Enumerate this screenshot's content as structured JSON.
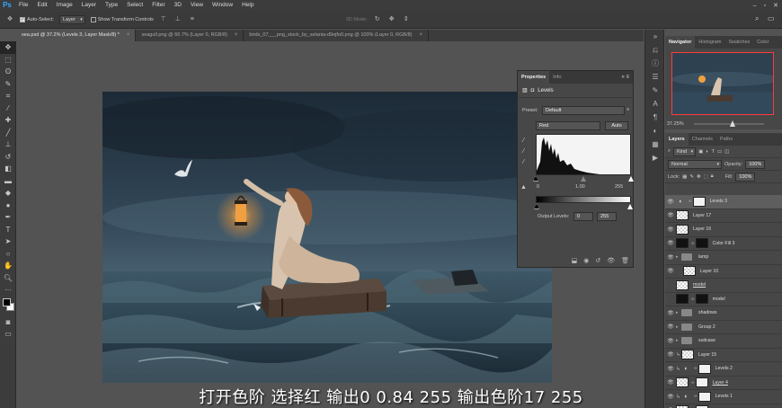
{
  "app": {
    "logo": "Ps"
  },
  "menu": [
    "File",
    "Edit",
    "Image",
    "Layer",
    "Type",
    "Select",
    "Filter",
    "3D",
    "View",
    "Window",
    "Help"
  ],
  "options_bar": {
    "auto_select_label": "Auto-Select:",
    "auto_select_target": "Layer",
    "show_transform_label": "Show Transform Controls",
    "mode_3d_label": "3D Mode:"
  },
  "tabs": [
    {
      "label": "sea.psd @ 37.2% (Levels 3, Layer Mask/8) *",
      "active": true
    },
    {
      "label": "seagull.png @ 66.7% (Layer 0, RGB/8)",
      "active": false
    },
    {
      "label": "birds_07___png_stock_by_selania-d9ejfo0.png @ 100% (Layer 0, RGB/8)",
      "active": false
    }
  ],
  "navigator": {
    "tabs": [
      "Navigator",
      "Histogram",
      "Swatches",
      "Color"
    ],
    "zoom": "37.25%"
  },
  "layers": {
    "tabs": [
      "Layers",
      "Channels",
      "Paths"
    ],
    "filter_kind": "Kind",
    "blend_mode": "Normal",
    "opacity_label": "Opacity:",
    "opacity_value": "100%",
    "lock_label": "Lock:",
    "fill_label": "Fill:",
    "fill_value": "100%",
    "items": [
      {
        "name": "Levels 3",
        "type": "adj",
        "mask": "white",
        "selected": true,
        "visible": true
      },
      {
        "name": "Layer 17",
        "type": "pixel",
        "thumb": "checker",
        "visible": true
      },
      {
        "name": "Layer 16",
        "type": "pixel",
        "thumb": "checker",
        "visible": true
      },
      {
        "name": "Color Fill 3",
        "type": "fill",
        "thumb": "black",
        "mask": "black",
        "visible": true
      },
      {
        "name": "lamp",
        "type": "group",
        "visible": true
      },
      {
        "name": "Layer 10",
        "type": "pixel",
        "thumb": "checker",
        "indent": 1,
        "visible": true
      },
      {
        "name": "model",
        "type": "pixel",
        "thumb": "checker",
        "underline": true,
        "visible": false
      },
      {
        "name": "model",
        "type": "pixel",
        "thumb": "black",
        "mask": "black",
        "visible": false
      },
      {
        "name": "shadows",
        "type": "group",
        "visible": true
      },
      {
        "name": "Group 2",
        "type": "group",
        "visible": true
      },
      {
        "name": "suitcase",
        "type": "group",
        "visible": true
      },
      {
        "name": "Layer 15",
        "type": "pixel",
        "thumb": "checker",
        "clip": true,
        "visible": true
      },
      {
        "name": "Levels 2",
        "type": "adj",
        "mask": "white",
        "clip": true,
        "visible": true
      },
      {
        "name": "Layer 4",
        "type": "pixel",
        "thumb": "checker",
        "mask": "white",
        "underline": true,
        "visible": true
      },
      {
        "name": "Levels 1",
        "type": "adj",
        "mask": "white",
        "clip": true,
        "visible": true
      },
      {
        "name": "Layer 3",
        "type": "pixel",
        "thumb": "checker",
        "mask": "white",
        "underline": true,
        "visible": true
      }
    ]
  },
  "properties": {
    "tabs": [
      "Properties",
      "Info"
    ],
    "header": "Levels",
    "preset_label": "Preset:",
    "preset_value": "Default",
    "channel": "Red",
    "auto_label": "Auto",
    "input_levels": [
      "0",
      "1.00",
      "255"
    ],
    "output_levels_label": "Output Levels:",
    "output_levels": [
      "0",
      "255"
    ]
  },
  "subtitle": "打开色阶  选择红  输出0  0.84  255  输出色阶17  255"
}
